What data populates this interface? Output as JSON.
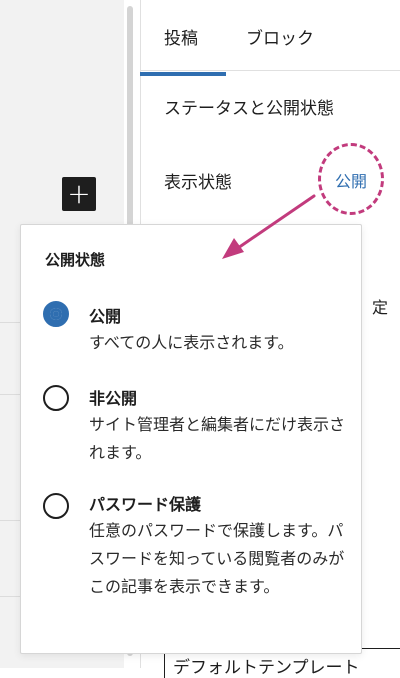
{
  "tabs": [
    {
      "label": "投稿",
      "active": true
    },
    {
      "label": "ブロック",
      "active": false
    }
  ],
  "panel": {
    "title": "ステータスと公開状態",
    "visibility_label": "表示状態",
    "visibility_value": "公開",
    "clipped_char": "定",
    "bottom_field": "デフォルトテンプレート"
  },
  "inserter": {
    "symbol": "+"
  },
  "popover": {
    "title": "公開状態",
    "options": [
      {
        "label": "公開",
        "desc": "すべての人に表示されます。",
        "checked": true
      },
      {
        "label": "非公開",
        "desc": "サイト管理者と編集者にだけ表示されます。",
        "checked": false
      },
      {
        "label": "パスワード保護",
        "desc": "任意のパスワードで保護します。パスワードを知っている閲覧者のみがこの記事を表示できます。",
        "checked": false
      }
    ]
  },
  "colors": {
    "accent": "#2f6eb0",
    "annotation": "#c23b7d"
  }
}
